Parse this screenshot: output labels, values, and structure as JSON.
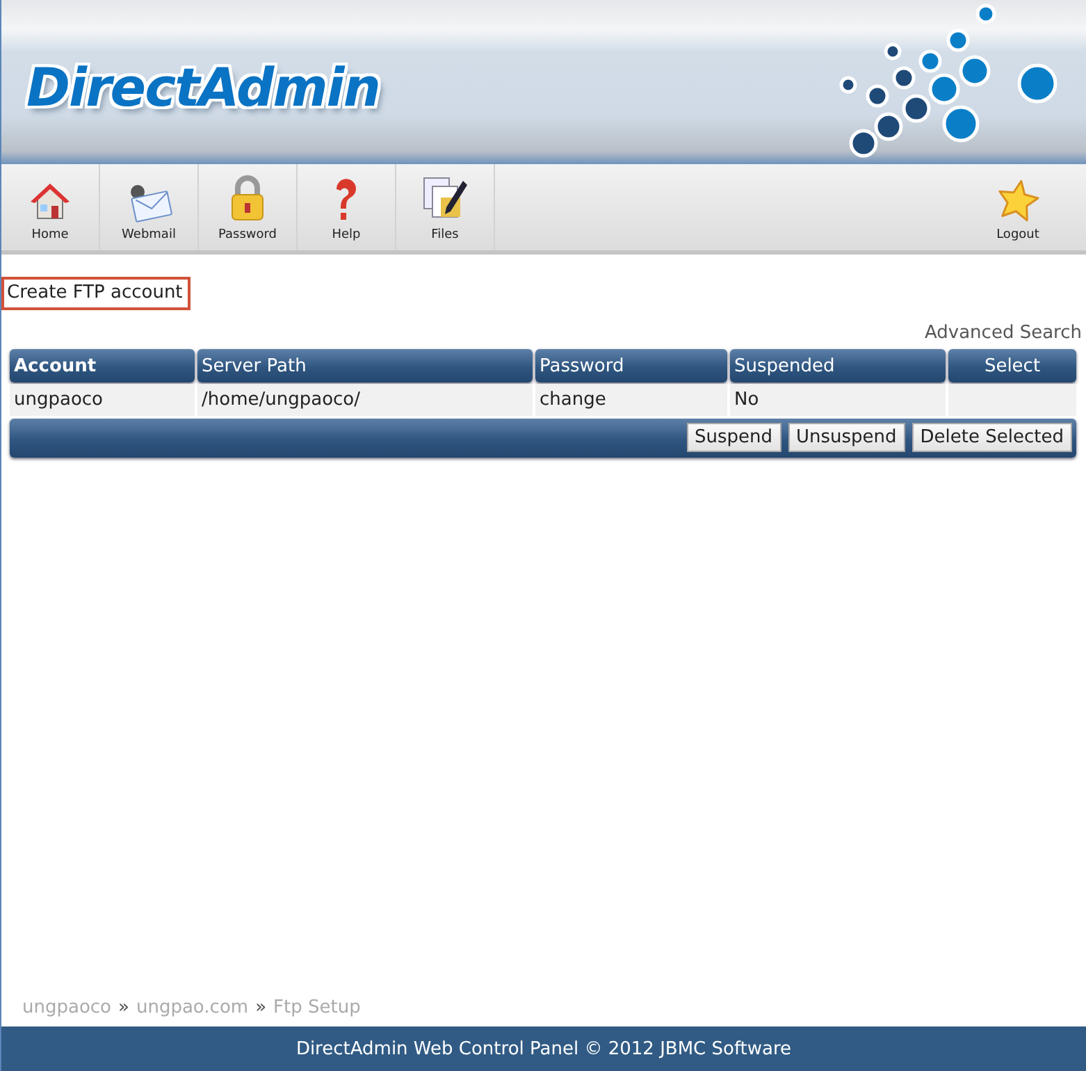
{
  "header": {
    "logo": "DirectAdmin"
  },
  "toolbar": {
    "items": [
      {
        "label": "Home",
        "kind": "home"
      },
      {
        "label": "Webmail",
        "kind": "mail"
      },
      {
        "label": "Password",
        "kind": "lock"
      },
      {
        "label": "Help",
        "kind": "help"
      },
      {
        "label": "Files",
        "kind": "files"
      }
    ],
    "logout": {
      "label": "Logout",
      "kind": "star"
    }
  },
  "create_link": "Create FTP account",
  "advanced_search": "Advanced Search",
  "table": {
    "columns": [
      "Account",
      "Server Path",
      "Password",
      "Suspended",
      "Select"
    ],
    "rows": [
      {
        "account": "ungpaoco",
        "server_path": "/home/ungpaoco/",
        "password": "change",
        "suspended": "No"
      }
    ],
    "buttons": [
      "Suspend",
      "Unsuspend",
      "Delete Selected"
    ]
  },
  "breadcrumb": [
    {
      "text": "ungpaoco",
      "kind": "link"
    },
    {
      "text": "»",
      "kind": "separator"
    },
    {
      "text": "ungpao.com",
      "kind": "link"
    },
    {
      "text": "»",
      "kind": "separator"
    },
    {
      "text": "Ftp Setup",
      "kind": "current"
    }
  ],
  "footer": "DirectAdmin Web Control Panel © 2012 JBMC Software"
}
